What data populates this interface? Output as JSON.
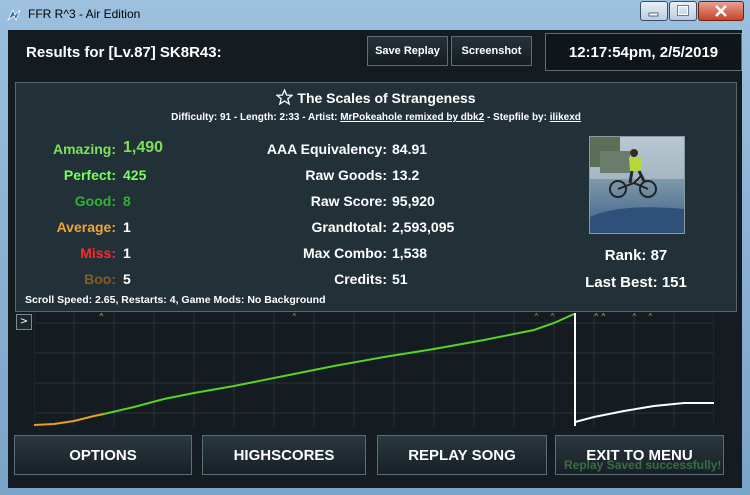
{
  "window": {
    "title": "FFR R^3 - Air Edition"
  },
  "header": {
    "results_label": "Results for [Lv.87] SK8R43:",
    "save_replay": "Save Replay",
    "screenshot": "Screenshot",
    "datetime": "12:17:54pm, 2/5/2019"
  },
  "song": {
    "title": "The Scales of Strangeness",
    "difficulty_text": "Difficulty: 91 - Length: 2:33 - Artist:",
    "artist": "MrPokeahole remixed by dbk2",
    "stepfile_label": "- Stepfile by:",
    "stepfile_author": "ilikexd"
  },
  "judgements": [
    {
      "label": "Amazing:",
      "value": "1,490",
      "color": "#7ee05a"
    },
    {
      "label": "Perfect:",
      "value": "425",
      "color": "#78ff5c"
    },
    {
      "label": "Good:",
      "value": "8",
      "color": "#2fb52f"
    },
    {
      "label": "Average:",
      "value": "1",
      "color": "#f2a33a"
    },
    {
      "label": "Miss:",
      "value": "1",
      "color": "#ff2a2a"
    },
    {
      "label": "Boo:",
      "value": "5",
      "color": "#8a5a1f"
    }
  ],
  "stats": [
    {
      "label": "AAA Equivalency:",
      "value": "84.91"
    },
    {
      "label": "Raw Goods:",
      "value": "13.2"
    },
    {
      "label": "Raw Score:",
      "value": "95,920"
    },
    {
      "label": "Grandtotal:",
      "value": "2,593,095"
    },
    {
      "label": "Max Combo:",
      "value": "1,538"
    },
    {
      "label": "Credits:",
      "value": "51"
    }
  ],
  "rank": "Rank: 87",
  "last_best": "Last Best: 151",
  "scroll_info": "Scroll Speed: 2.65, Restarts: 4, Game Mods: No Background",
  "expand_label": ">",
  "buttons": {
    "options": "OPTIONS",
    "highscores": "HIGHSCORES",
    "replay": "REPLAY SONG",
    "exit": "EXIT TO MENU"
  },
  "notice": "Replay Saved successfully!",
  "colors": {
    "accent_green": "#5ad32a",
    "miss_marker": "#3fae48",
    "boo_marker": "#c98a3a"
  },
  "icons": [
    "star-icon",
    "app-icon",
    "minimize-icon",
    "maximize-icon",
    "close-icon"
  ]
}
